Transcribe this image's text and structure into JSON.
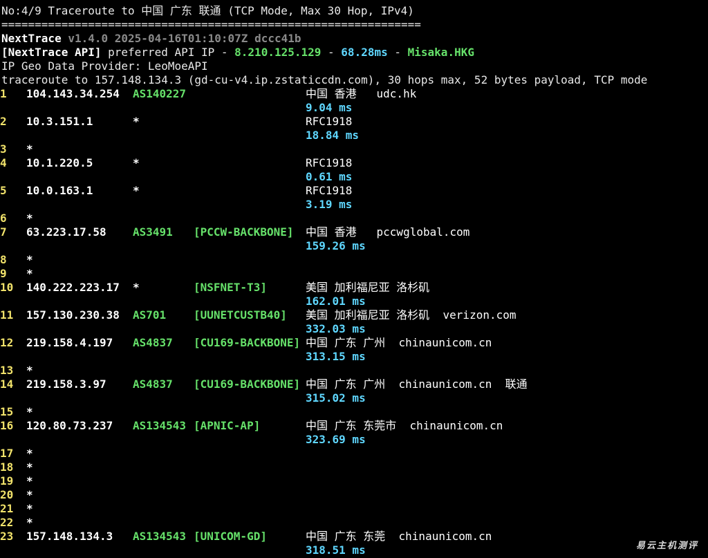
{
  "header": {
    "title": "No:4/9 Traceroute to 中国 广东 联通 (TCP Mode, Max 30 Hop, IPv4)",
    "rule": "==============================================================="
  },
  "info": {
    "tool": "NextTrace",
    "version": "v1.4.0 2025-04-16T01:10:07Z dccc41b",
    "api_label": "[NextTrace API]",
    "api_text": " preferred API IP - ",
    "api_ip": "8.210.125.129",
    "dash": " - ",
    "api_ms": "68.28ms",
    "api_node": "Misaka.HKG",
    "geo_provider": "IP Geo Data Provider: LeoMoeAPI",
    "traceroute": "traceroute to 157.148.134.3 (gd-cu-v4.ip.zstaticcdn.com), 30 hops max, 52 bytes payload, TCP mode"
  },
  "hops": [
    {
      "n": "1",
      "ip": "104.143.34.254",
      "asn": "AS140227",
      "tag": "",
      "geo": "中国 香港   udc.hk",
      "ms": "9.04 ms"
    },
    {
      "n": "2",
      "ip": "10.3.151.1",
      "asn": "*",
      "tag": "",
      "geo": "RFC1918",
      "ms": "18.84 ms"
    },
    {
      "n": "3",
      "star": "*"
    },
    {
      "n": "4",
      "ip": "10.1.220.5",
      "asn": "*",
      "tag": "",
      "geo": "RFC1918",
      "ms": "0.61 ms"
    },
    {
      "n": "5",
      "ip": "10.0.163.1",
      "asn": "*",
      "tag": "",
      "geo": "RFC1918",
      "ms": "3.19 ms"
    },
    {
      "n": "6",
      "star": "*"
    },
    {
      "n": "7",
      "ip": "63.223.17.58",
      "asn": "AS3491",
      "tag": "[PCCW-BACKBONE]",
      "geo": "中国 香港   pccwglobal.com",
      "ms": "159.26 ms"
    },
    {
      "n": "8",
      "star": "*"
    },
    {
      "n": "9",
      "star": "*"
    },
    {
      "n": "10",
      "ip": "140.222.223.17",
      "asn": "*",
      "tag": "[NSFNET-T3]",
      "geo": "美国 加利福尼亚 洛杉矶",
      "ms": "162.01 ms"
    },
    {
      "n": "11",
      "ip": "157.130.230.38",
      "asn": "AS701",
      "tag": "[UUNETCUSTB40]",
      "geo": "美国 加利福尼亚 洛杉矶  verizon.com",
      "ms": "332.03 ms"
    },
    {
      "n": "12",
      "ip": "219.158.4.197",
      "asn": "AS4837",
      "tag": "[CU169-BACKBONE]",
      "geo": "中国 广东 广州  chinaunicom.cn",
      "ms": "313.15 ms"
    },
    {
      "n": "13",
      "star": "*"
    },
    {
      "n": "14",
      "ip": "219.158.3.97",
      "asn": "AS4837",
      "tag": "[CU169-BACKBONE]",
      "geo": "中国 广东 广州  chinaunicom.cn  联通",
      "ms": "315.02 ms"
    },
    {
      "n": "15",
      "star": "*"
    },
    {
      "n": "16",
      "ip": "120.80.73.237",
      "asn": "AS134543",
      "tag": "[APNIC-AP]",
      "geo": "中国 广东 东莞市  chinaunicom.cn",
      "ms": "323.69 ms"
    },
    {
      "n": "17",
      "star": "*"
    },
    {
      "n": "18",
      "star": "*"
    },
    {
      "n": "19",
      "star": "*"
    },
    {
      "n": "20",
      "star": "*"
    },
    {
      "n": "21",
      "star": "*"
    },
    {
      "n": "22",
      "star": "*"
    },
    {
      "n": "23",
      "ip": "157.148.134.3",
      "asn": "AS134543",
      "tag": "[UNICOM-GD]",
      "geo": "中国 广东 东莞  chinaunicom.cn",
      "ms": "318.51 ms"
    }
  ],
  "watermark": "易云主机测评",
  "colors": {
    "background": "#000000",
    "asn": "#66e16a",
    "latency": "#5fd7ff",
    "hop_number": "#f2e36b",
    "api_ip": "#66e16a"
  }
}
